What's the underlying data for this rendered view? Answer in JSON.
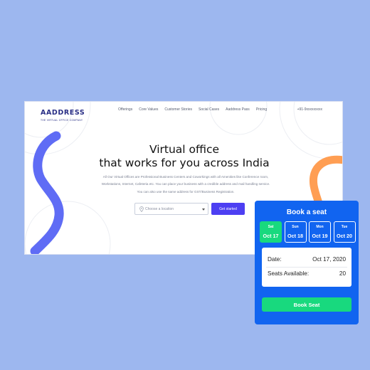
{
  "site": {
    "logo": {
      "word": "AADDRESS",
      "tagline": "THE VIRTUAL OFFICE COMPANY"
    },
    "nav": [
      "Offerings",
      "Core Values",
      "Customer Stories",
      "Social Cases",
      "Aaddress Pass",
      "Pricing"
    ],
    "phone": "+91-9xxxxxxxxx",
    "hero": {
      "title_line1": "Virtual office",
      "title_line2": "that works for you across India",
      "desc_line1": "All Our Virtual Offices are Professional Business Centers and Coworkings with all Amenities like Conference room,",
      "desc_line2": "Workstations, Internet, Cafeteria etc. You can place your business with a credible address and mail handling service.",
      "desc_line3": "You can also use the same address for GST/Business Registration."
    },
    "location_placeholder": "Choose a location",
    "cta_label": "Get started",
    "colors": {
      "brand": "#2a2f86",
      "cta": "#4d3ff2",
      "wave_blue": "#5f6cf5",
      "wave_orange": "#ff9e53"
    }
  },
  "widget": {
    "title": "Book a seat",
    "days": [
      {
        "name": "Sat",
        "date": "Oct 17",
        "selected": true
      },
      {
        "name": "Sun",
        "date": "Oct 18",
        "selected": false
      },
      {
        "name": "Mon",
        "date": "Oct 19",
        "selected": false
      },
      {
        "name": "Tue",
        "date": "Oct 20",
        "selected": false
      }
    ],
    "date_label": "Date:",
    "date_value": "Oct 17, 2020",
    "seats_label": "Seats Available:",
    "seats_value": "20",
    "button_label": "Book Seat",
    "colors": {
      "panel": "#1164f0",
      "accent": "#18d97e"
    }
  }
}
